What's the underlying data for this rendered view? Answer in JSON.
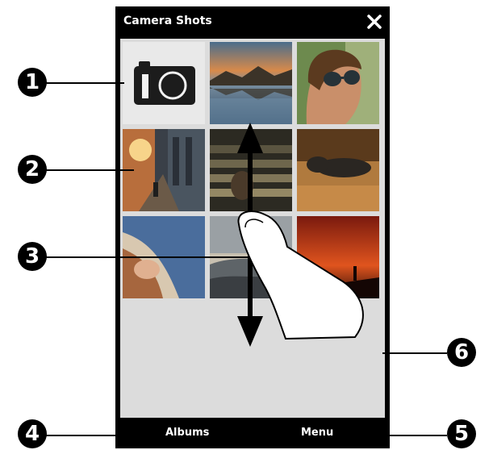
{
  "window": {
    "title": "Camera Shots",
    "close_icon": "close-icon"
  },
  "grid": {
    "tiles": [
      {
        "name": "camera-launcher-tile",
        "icon": "camera-icon"
      },
      {
        "name": "photo-thumbnail-lake-sunset"
      },
      {
        "name": "photo-thumbnail-woman-sunglasses"
      },
      {
        "name": "photo-thumbnail-street-sunset"
      },
      {
        "name": "photo-thumbnail-stairs"
      },
      {
        "name": "photo-thumbnail-sleeping-dog"
      },
      {
        "name": "photo-thumbnail-woman-hair"
      },
      {
        "name": "photo-thumbnail-beach"
      },
      {
        "name": "photo-thumbnail-red-sunset"
      }
    ]
  },
  "softkeys": {
    "left": "Albums",
    "right": "Menu"
  },
  "callouts": [
    "1",
    "2",
    "3",
    "4",
    "5",
    "6"
  ],
  "colors": {
    "bar": "#000000",
    "background": "#dcdcdc",
    "callout": "#000000"
  }
}
